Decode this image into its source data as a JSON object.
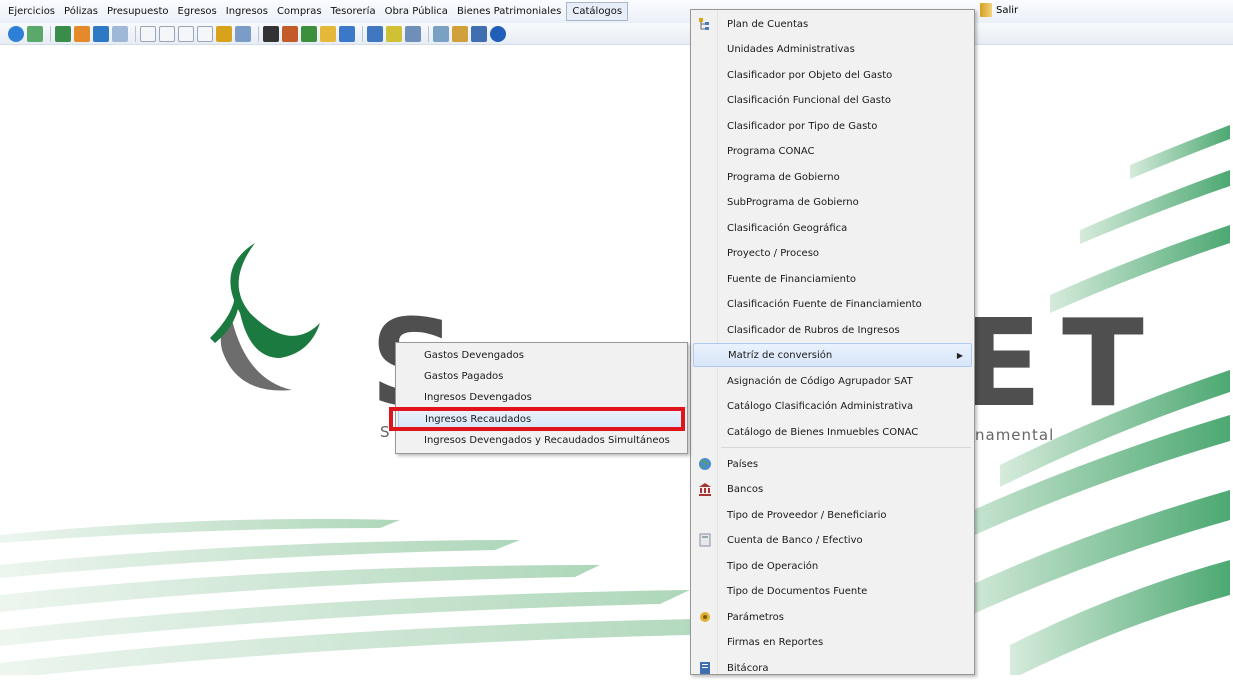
{
  "menubar": {
    "items": [
      "Ejercicios",
      "Pólizas",
      "Presupuesto",
      "Egresos",
      "Ingresos",
      "Compras",
      "Tesorería",
      "Obra Pública",
      "Bienes Patrimoniales",
      "Catálogos"
    ],
    "salir": "Salir"
  },
  "brand": {
    "left_letter": "S",
    "right_letters": "ET",
    "tagline_left": "S",
    "tagline_right": "namental"
  },
  "catalogos_menu": {
    "items": [
      {
        "label": "Plan de Cuentas",
        "icon": "tree-icon"
      },
      {
        "label": "Unidades Administrativas"
      },
      {
        "label": "Clasificador por Objeto del Gasto"
      },
      {
        "label": "Clasificación Funcional del Gasto"
      },
      {
        "label": "Clasificador por Tipo de Gasto"
      },
      {
        "label": "Programa CONAC"
      },
      {
        "label": "Programa de Gobierno"
      },
      {
        "label": "SubPrograma de Gobierno"
      },
      {
        "label": "Clasificación Geográfica"
      },
      {
        "label": "Proyecto / Proceso"
      },
      {
        "label": "Fuente de Financiamiento"
      },
      {
        "label": "Clasificación Fuente de Financiamiento"
      },
      {
        "label": "Clasificador de Rubros de Ingresos"
      },
      {
        "label": "Matríz de conversión",
        "submenu": true
      },
      {
        "label": "Asignación de Código Agrupador SAT"
      },
      {
        "label": "Catálogo Clasificación Administrativa"
      },
      {
        "label": "Catálogo de Bienes Inmuebles CONAC"
      },
      {
        "label": "Países",
        "icon": "globe-icon"
      },
      {
        "label": "Bancos",
        "icon": "bank-icon"
      },
      {
        "label": "Tipo de Proveedor / Beneficiario"
      },
      {
        "label": "Cuenta de Banco / Efectivo",
        "icon": "calculator-icon"
      },
      {
        "label": "Tipo de Operación"
      },
      {
        "label": "Tipo de Documentos Fuente"
      },
      {
        "label": "Parámetros",
        "icon": "settings-icon"
      },
      {
        "label": "Firmas en Reportes"
      },
      {
        "label": "Bitácora",
        "icon": "log-icon"
      }
    ]
  },
  "matriz_submenu": {
    "items": [
      "Gastos Devengados",
      "Gastos Pagados",
      "Ingresos Devengados",
      "Ingresos Recaudados",
      "Ingresos Devengados y Recaudados Simultáneos"
    ],
    "selected_index": 3
  },
  "colors": {
    "brand_green": "#1b7a3f",
    "highlight_red": "#e0141c",
    "menu_hover": "#d7e6f9"
  }
}
